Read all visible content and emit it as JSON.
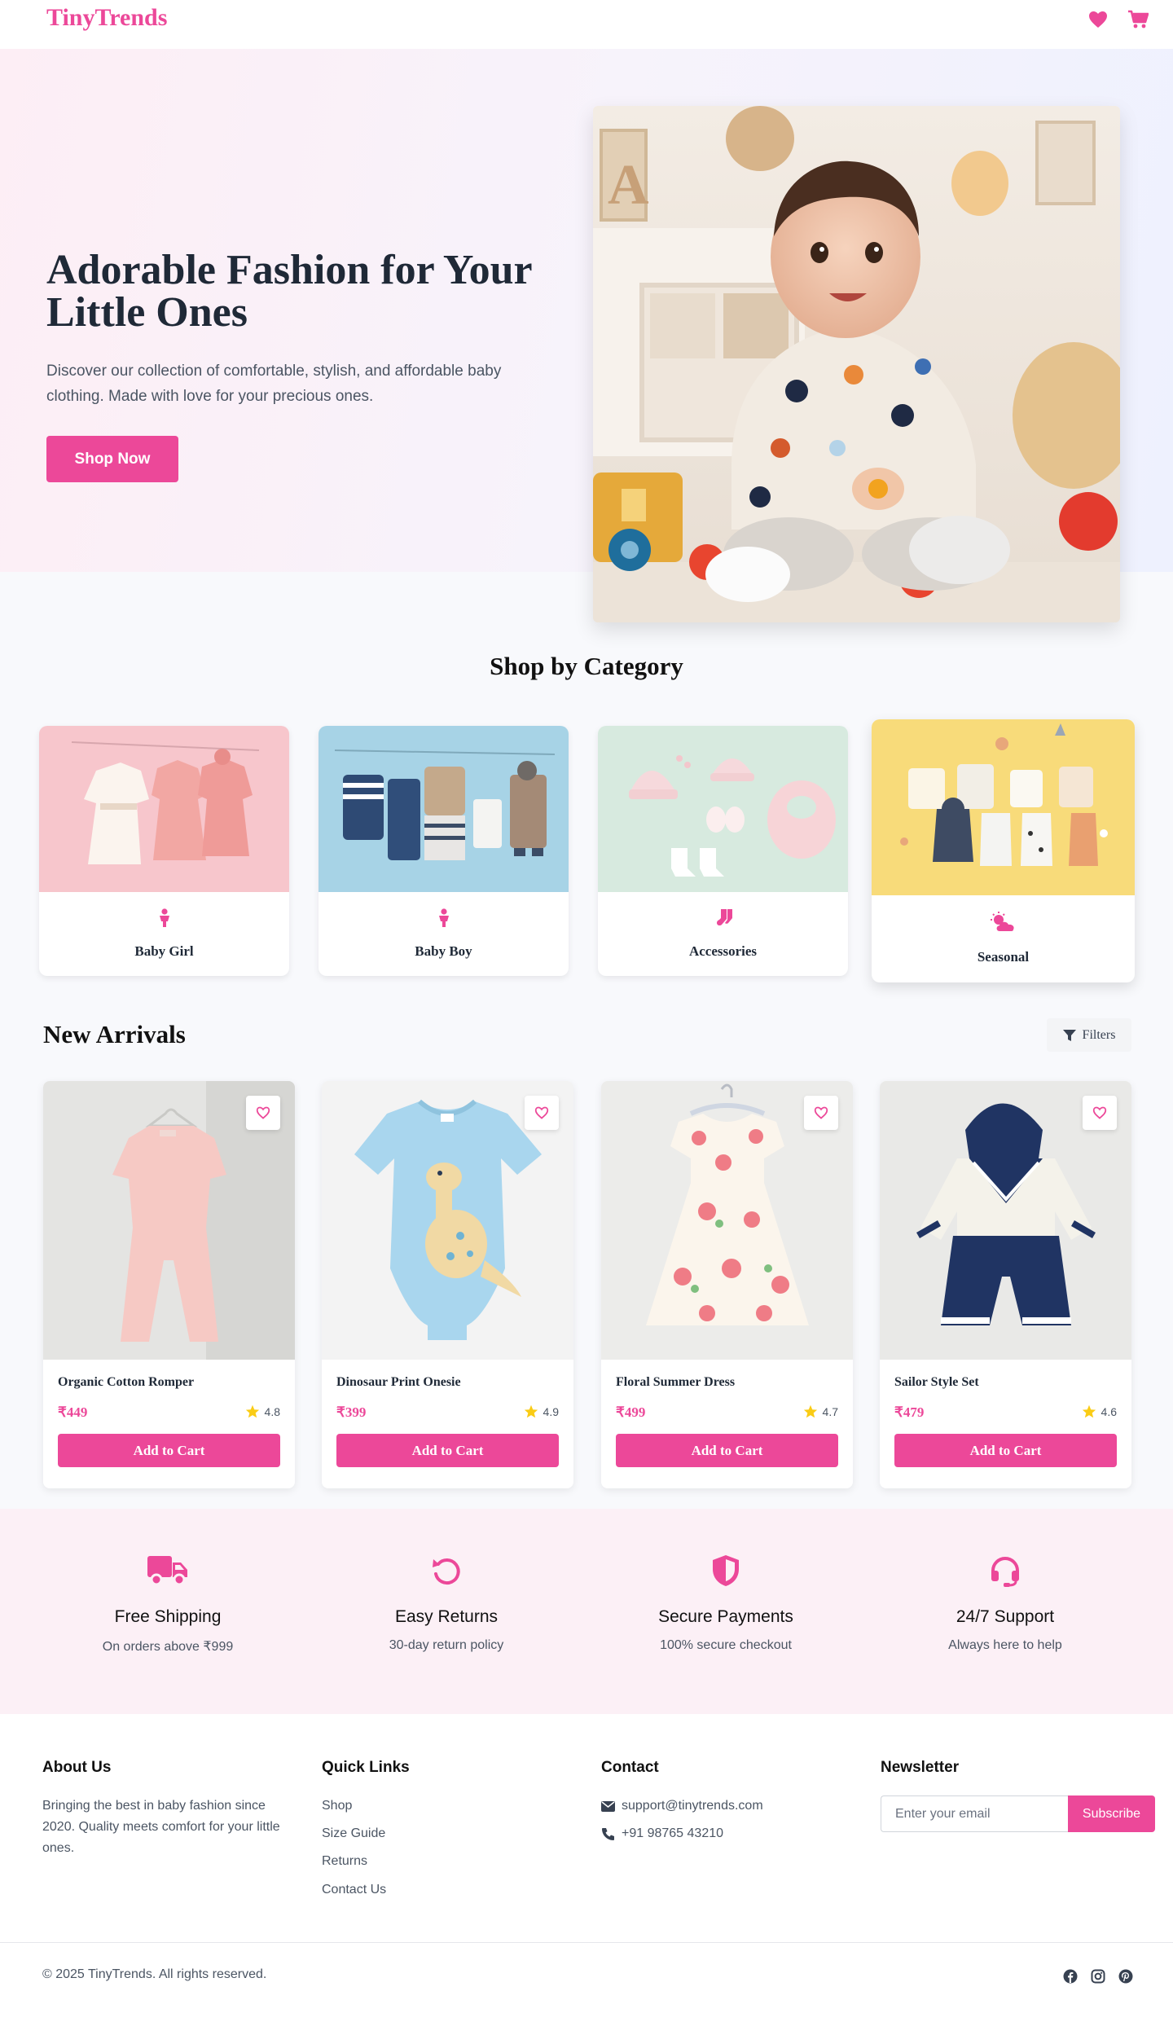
{
  "brand": {
    "logo": "TinyTrends",
    "accent": "#ec4899"
  },
  "header": {
    "wishlist_icon": "heart-icon",
    "cart_icon": "cart-icon"
  },
  "hero": {
    "title": "Adorable Fashion for Your Little Ones",
    "description": "Discover our collection of comfortable, stylish, and affordable baby clothing. Made with love for your precious ones.",
    "cta": "Shop Now"
  },
  "categories": {
    "title": "Shop by Category",
    "items": [
      {
        "label": "Baby Girl",
        "icon": "child-icon"
      },
      {
        "label": "Baby Boy",
        "icon": "child-icon"
      },
      {
        "label": "Accessories",
        "icon": "socks-icon"
      },
      {
        "label": "Seasonal",
        "icon": "cloud-sun-icon"
      }
    ]
  },
  "new_arrivals": {
    "title": "New Arrivals",
    "filters_label": "Filters",
    "products": [
      {
        "name": "Organic Cotton Romper",
        "price": "₹449",
        "rating": "4.8",
        "button": "Add to Cart"
      },
      {
        "name": "Dinosaur Print Onesie",
        "price": "₹399",
        "rating": "4.9",
        "button": "Add to Cart"
      },
      {
        "name": "Floral Summer Dress",
        "price": "₹499",
        "rating": "4.7",
        "button": "Add to Cart"
      },
      {
        "name": "Sailor Style Set",
        "price": "₹479",
        "rating": "4.6",
        "button": "Add to Cart"
      }
    ]
  },
  "features": [
    {
      "title": "Free Shipping",
      "subtitle": "On orders above ₹999",
      "icon": "truck-icon"
    },
    {
      "title": "Easy Returns",
      "subtitle": "30-day return policy",
      "icon": "undo-icon"
    },
    {
      "title": "Secure Payments",
      "subtitle": "100% secure checkout",
      "icon": "shield-icon"
    },
    {
      "title": "24/7 Support",
      "subtitle": "Always here to help",
      "icon": "headset-icon"
    }
  ],
  "footer": {
    "about": {
      "title": "About Us",
      "text": "Bringing the best in baby fashion since 2020. Quality meets comfort for your little ones."
    },
    "quick_links": {
      "title": "Quick Links",
      "items": [
        "Shop",
        "Size Guide",
        "Returns",
        "Contact Us"
      ]
    },
    "contact": {
      "title": "Contact",
      "email": "support@tinytrends.com",
      "phone": "+91 98765 43210"
    },
    "newsletter": {
      "title": "Newsletter",
      "placeholder": "Enter your email",
      "button": "Subscribe"
    },
    "copyright": "© 2025 TinyTrends. All rights reserved.",
    "social": [
      "facebook-icon",
      "instagram-icon",
      "pinterest-icon"
    ]
  }
}
